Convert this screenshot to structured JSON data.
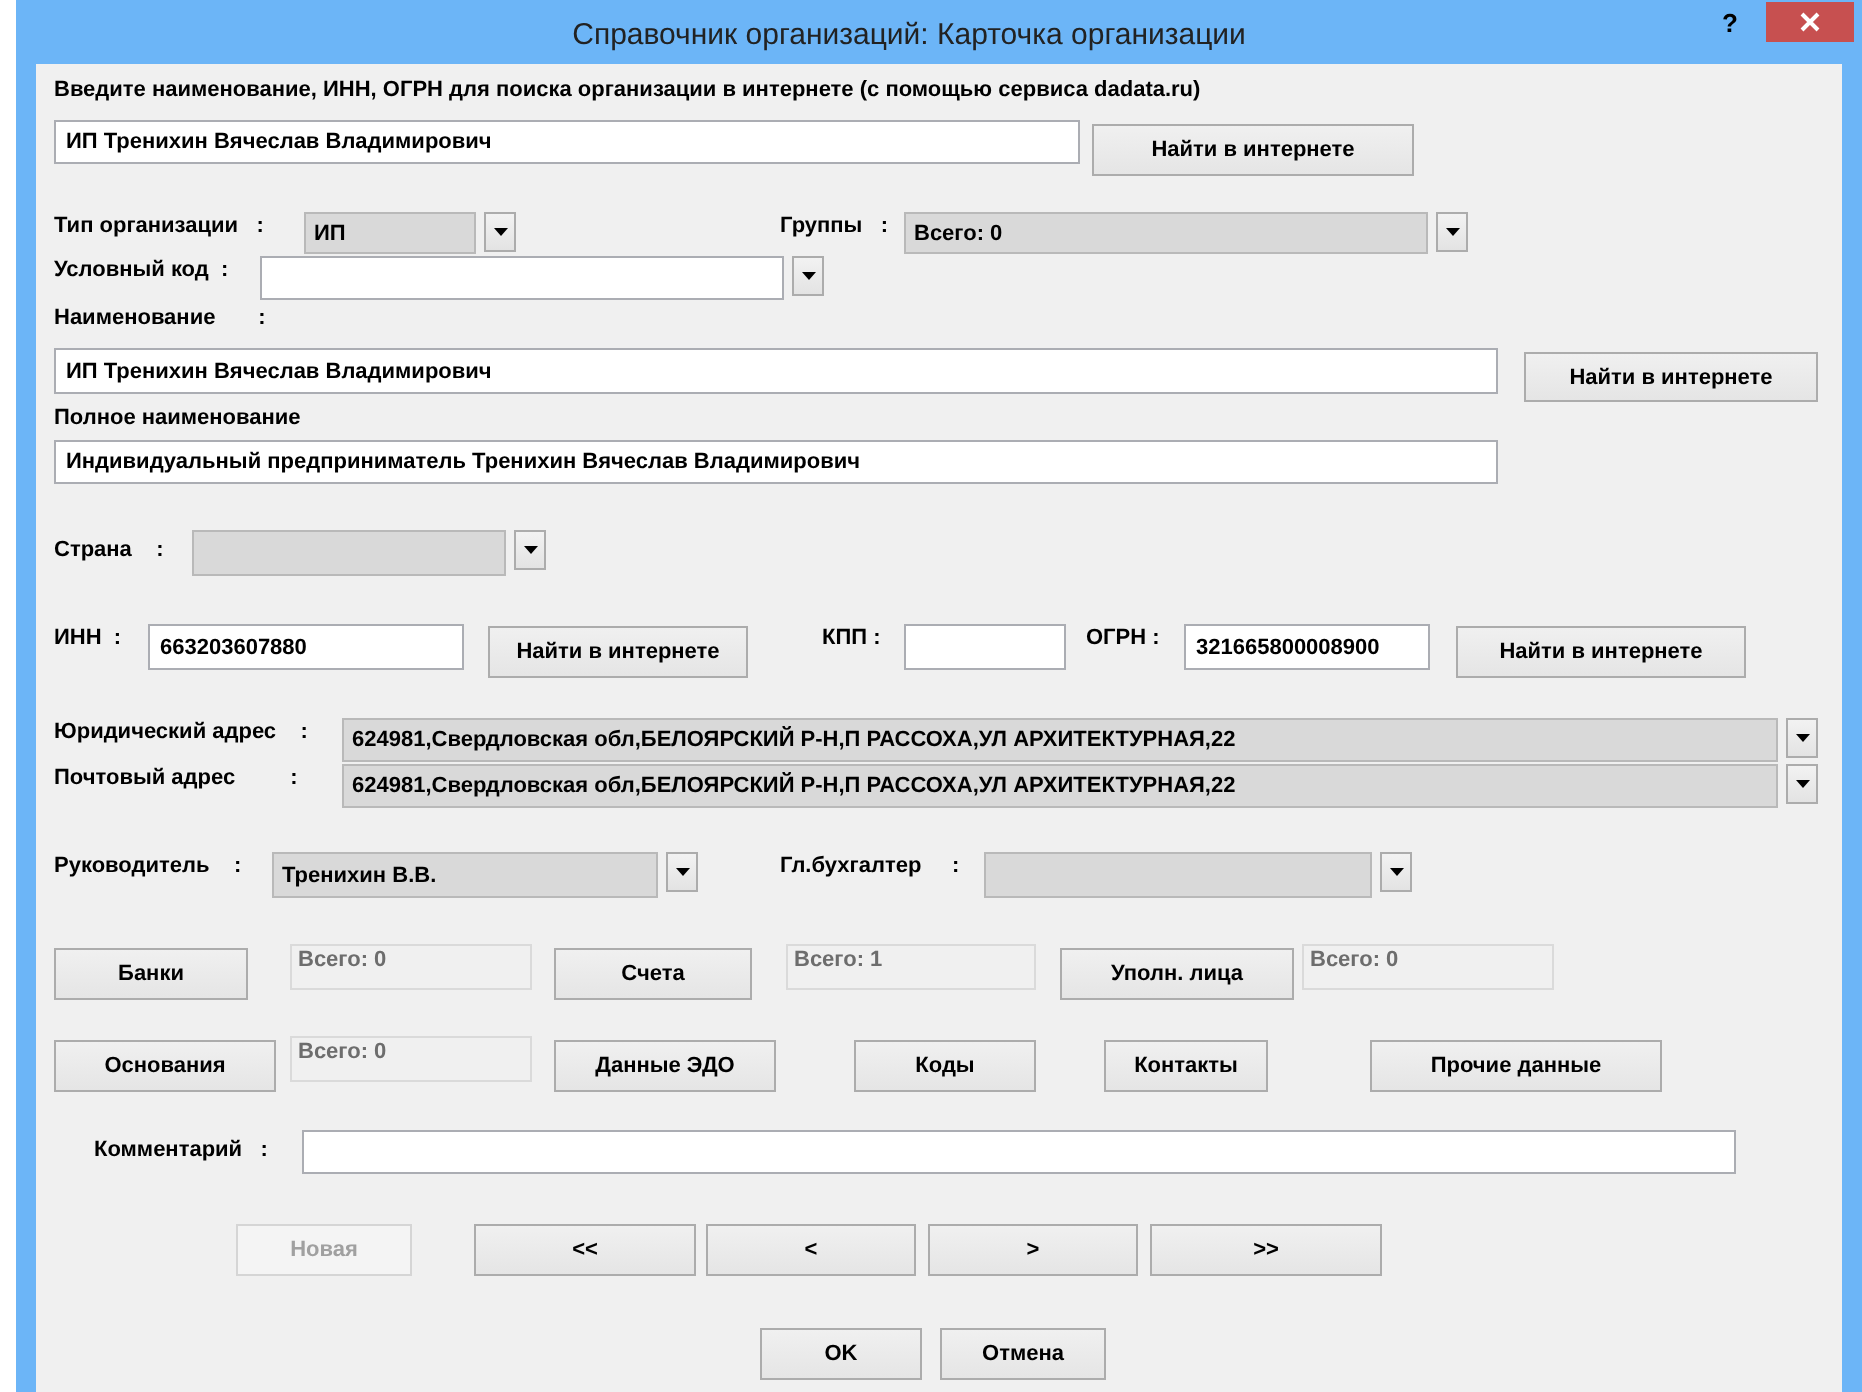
{
  "window": {
    "title": "Справочник организаций: Карточка организации",
    "help": "?"
  },
  "form": {
    "controls": [
      {
        "kind": "label",
        "text": "Введите наименование, ИНН, ОГРН для поиска организации в интернете (с помощью сервиса dadata.ru)"
      },
      {
        "kind": "field",
        "value": "ИП Тренихин Вячеслав Владимирович"
      },
      {
        "kind": "button",
        "label": "Найти в интернете",
        "disabled": false
      },
      {
        "kind": "label",
        "text": "Тип организации   :"
      },
      {
        "kind": "combo",
        "value": "ИП",
        "readonly": true
      },
      {
        "kind": "label",
        "text": "Группы   :"
      },
      {
        "kind": "combo",
        "value": "Всего: 0",
        "readonly": true
      },
      {
        "kind": "label",
        "text": "Условный код  :"
      },
      {
        "kind": "combo",
        "readonly": false
      },
      {
        "kind": "label",
        "text": "Наименование       :"
      },
      {
        "kind": "field",
        "value": "ИП Тренихин Вячеслав Владимирович"
      },
      {
        "kind": "button",
        "label": "Найти в интернете",
        "disabled": false
      },
      {
        "kind": "label",
        "text": "Полное наименование"
      },
      {
        "kind": "field",
        "value": "Индивидуальный предприниматель Тренихин Вячеслав Владимирович"
      },
      {
        "kind": "label",
        "text": "Страна    :"
      },
      {
        "kind": "combo",
        "readonly": true
      },
      {
        "kind": "label",
        "text": "ИНН  :"
      },
      {
        "kind": "field",
        "value": "663203607880"
      },
      {
        "kind": "button",
        "label": "Найти в интернете",
        "disabled": false
      },
      {
        "kind": "label",
        "text": "КПП :"
      },
      {
        "kind": "field"
      },
      {
        "kind": "label",
        "text": "ОГРН :"
      },
      {
        "kind": "field",
        "value": "321665800008900"
      },
      {
        "kind": "button",
        "label": "Найти в интернете",
        "disabled": false
      },
      {
        "kind": "label",
        "text": "Юридический адрес    :"
      },
      {
        "kind": "combo",
        "value": "624981,Свердловская обл,БЕЛОЯРСКИЙ Р-Н,П РАССОХА,УЛ АРХИТЕКТУРНАЯ,22",
        "readonly": true
      },
      {
        "kind": "label",
        "text": "Почтовый адрес         :"
      },
      {
        "kind": "combo",
        "value": "624981,Свердловская обл,БЕЛОЯРСКИЙ Р-Н,П РАССОХА,УЛ АРХИТЕКТУРНАЯ,22",
        "readonly": true
      },
      {
        "kind": "label",
        "text": "Руководитель    :"
      },
      {
        "kind": "combo",
        "value": "Тренихин В.В.",
        "readonly": true
      },
      {
        "kind": "label",
        "text": "Гл.бухгалтер     :"
      },
      {
        "kind": "combo",
        "readonly": true
      },
      {
        "kind": "button",
        "label": "Банки",
        "disabled": false
      },
      {
        "kind": "counter",
        "value": "Всего: 0"
      },
      {
        "kind": "button",
        "label": "Счета",
        "disabled": false
      },
      {
        "kind": "counter",
        "value": "Всего: 1"
      },
      {
        "kind": "button",
        "label": "Уполн. лица",
        "disabled": false
      },
      {
        "kind": "counter",
        "value": "Всего: 0"
      },
      {
        "kind": "button",
        "label": "Основания",
        "disabled": false
      },
      {
        "kind": "counter",
        "value": "Всего: 0"
      },
      {
        "kind": "button",
        "label": "Данные ЭДО",
        "disabled": false
      },
      {
        "kind": "button",
        "label": "Коды",
        "disabled": false
      },
      {
        "kind": "button",
        "label": "Контакты",
        "disabled": false
      },
      {
        "kind": "button",
        "label": "Прочие данные",
        "disabled": false
      },
      {
        "kind": "label",
        "text": "Комментарий   :"
      },
      {
        "kind": "field"
      },
      {
        "kind": "button",
        "label": "Новая",
        "disabled": true
      },
      {
        "kind": "button",
        "label": "<<",
        "disabled": false
      },
      {
        "kind": "button",
        "label": "<",
        "disabled": false
      },
      {
        "kind": "button",
        "label": ">",
        "disabled": false
      },
      {
        "kind": "button",
        "label": ">>",
        "disabled": false
      },
      {
        "kind": "button",
        "label": "OK",
        "disabled": false
      },
      {
        "kind": "button",
        "label": "Отмена",
        "disabled": false
      }
    ]
  }
}
